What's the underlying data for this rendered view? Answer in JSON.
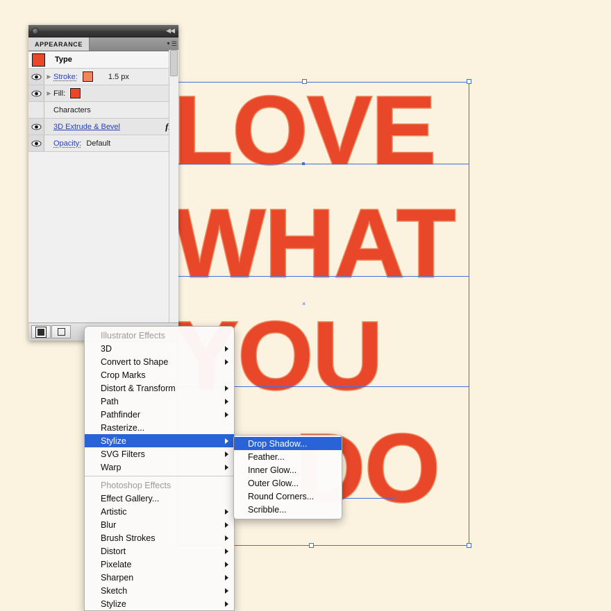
{
  "app": {
    "background_color": "#fbf2e0",
    "selection_color": "#3f6fe0"
  },
  "artwork": {
    "lines": [
      "LOVE",
      "WHAT",
      "YOU",
      "DO"
    ],
    "face_color": "#e8472a",
    "highlight_color": "#ef8a5f",
    "extrude_color": "#8e1a17"
  },
  "panel": {
    "window_title": "",
    "tab_label": "APPEARANCE",
    "menu_icon": "panel-menu-icon",
    "collapse_icon": "collapse-arrows-icon",
    "target_label": "Type",
    "target_swatch": "#e8472a",
    "rows": [
      {
        "label": "Stroke:",
        "link": true,
        "dotted": true,
        "swatch": "#f0865a",
        "value": "1.5 px",
        "eye": true,
        "disclosure": true
      },
      {
        "label": "Fill:",
        "link": false,
        "dotted": false,
        "swatch": "#e8472a",
        "value": "",
        "eye": true,
        "disclosure": true
      },
      {
        "label": "Characters",
        "link": false,
        "dotted": false,
        "swatch": "",
        "value": "",
        "eye": false,
        "disclosure": false
      },
      {
        "label": "3D Extrude & Bevel",
        "link": true,
        "dotted": false,
        "swatch": "",
        "value": "",
        "eye": true,
        "disclosure": false,
        "fx": "fx"
      },
      {
        "label": "Opacity:",
        "link": true,
        "dotted": true,
        "swatch": "",
        "value": "Default",
        "eye": true,
        "disclosure": false
      }
    ],
    "footer_buttons": [
      {
        "name": "add-new-stroke-button",
        "icon": "filled-square-icon"
      },
      {
        "name": "add-new-fill-button",
        "icon": "open-square-icon"
      }
    ]
  },
  "context_menu": {
    "sections": [
      {
        "title": "Illustrator Effects",
        "items": [
          {
            "label": "3D",
            "submenu": true
          },
          {
            "label": "Convert to Shape",
            "submenu": true
          },
          {
            "label": "Crop Marks",
            "submenu": false
          },
          {
            "label": "Distort & Transform",
            "submenu": true
          },
          {
            "label": "Path",
            "submenu": true
          },
          {
            "label": "Pathfinder",
            "submenu": true
          },
          {
            "label": "Rasterize...",
            "submenu": false
          },
          {
            "label": "Stylize",
            "submenu": true,
            "selected": true
          },
          {
            "label": "SVG Filters",
            "submenu": true
          },
          {
            "label": "Warp",
            "submenu": true
          }
        ]
      },
      {
        "title": "Photoshop Effects",
        "items": [
          {
            "label": "Effect Gallery...",
            "submenu": false
          },
          {
            "label": "Artistic",
            "submenu": true
          },
          {
            "label": "Blur",
            "submenu": true
          },
          {
            "label": "Brush Strokes",
            "submenu": true
          },
          {
            "label": "Distort",
            "submenu": true
          },
          {
            "label": "Pixelate",
            "submenu": true
          },
          {
            "label": "Sharpen",
            "submenu": true
          },
          {
            "label": "Sketch",
            "submenu": true
          },
          {
            "label": "Stylize",
            "submenu": true
          }
        ]
      }
    ],
    "highlight_color": "#2a62d8"
  },
  "submenu": {
    "items": [
      {
        "label": "Drop Shadow...",
        "selected": true
      },
      {
        "label": "Feather...",
        "selected": false
      },
      {
        "label": "Inner Glow...",
        "selected": false
      },
      {
        "label": "Outer Glow...",
        "selected": false
      },
      {
        "label": "Round Corners...",
        "selected": false
      },
      {
        "label": "Scribble...",
        "selected": false
      }
    ]
  }
}
